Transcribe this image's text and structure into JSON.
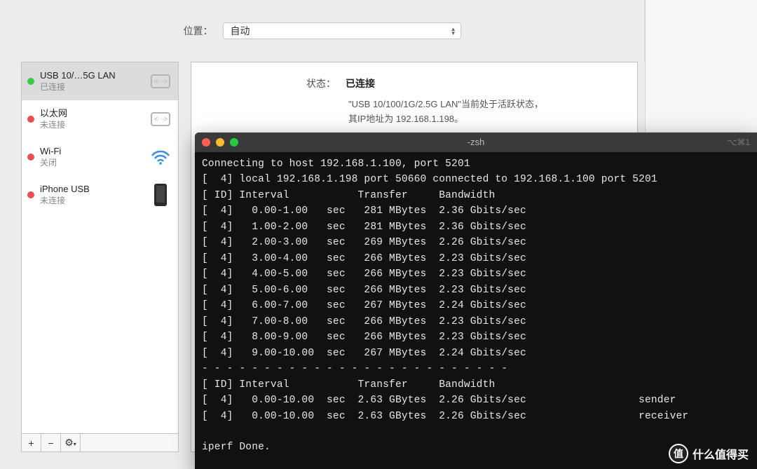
{
  "location": {
    "label": "位置：",
    "value": "自动"
  },
  "sidebar": {
    "items": [
      {
        "title": "USB 10/…5G LAN",
        "sub": "已连接",
        "status": "green",
        "icon": "ethernet",
        "selected": true
      },
      {
        "title": "以太网",
        "sub": "未连接",
        "status": "red",
        "icon": "ethernet",
        "selected": false
      },
      {
        "title": "Wi-Fi",
        "sub": "关闭",
        "status": "red",
        "icon": "wifi",
        "selected": false
      },
      {
        "title": "iPhone USB",
        "sub": "未连接",
        "status": "red",
        "icon": "phone",
        "selected": false
      }
    ],
    "footer": {
      "add": "+",
      "remove": "−",
      "gear": "⚙︎"
    }
  },
  "main": {
    "status_label": "状态：",
    "status_value": "已连接",
    "desc_line1": "\"USB 10/100/1G/2.5G LAN\"当前处于活跃状态，",
    "desc_line2": "其IP地址为 192.168.1.198。"
  },
  "terminal": {
    "title": "-zsh",
    "hint": "⌥⌘1",
    "connecting": "Connecting to host 192.168.1.100, port 5201",
    "local_line": "[  4] local 192.168.1.198 port 50660 connected to 192.168.1.100 port 5201",
    "header": "[ ID] Interval           Transfer     Bandwidth",
    "rows": [
      "[  4]   0.00-1.00   sec   281 MBytes  2.36 Gbits/sec",
      "[  4]   1.00-2.00   sec   281 MBytes  2.36 Gbits/sec",
      "[  4]   2.00-3.00   sec   269 MBytes  2.26 Gbits/sec",
      "[  4]   3.00-4.00   sec   266 MBytes  2.23 Gbits/sec",
      "[  4]   4.00-5.00   sec   266 MBytes  2.23 Gbits/sec",
      "[  4]   5.00-6.00   sec   266 MBytes  2.23 Gbits/sec",
      "[  4]   6.00-7.00   sec   267 MBytes  2.24 Gbits/sec",
      "[  4]   7.00-8.00   sec   266 MBytes  2.23 Gbits/sec",
      "[  4]   8.00-9.00   sec   266 MBytes  2.23 Gbits/sec",
      "[  4]   9.00-10.00  sec   267 MBytes  2.24 Gbits/sec"
    ],
    "separator": "- - - - - - - - - - - - - - - - - - - - - - - - -",
    "summary_header": "[ ID] Interval           Transfer     Bandwidth",
    "summary": [
      "[  4]   0.00-10.00  sec  2.63 GBytes  2.26 Gbits/sec                  sender",
      "[  4]   0.00-10.00  sec  2.63 GBytes  2.26 Gbits/sec                  receiver"
    ],
    "done": "iperf Done."
  },
  "watermark": {
    "badge": "值",
    "text": "什么值得买"
  }
}
